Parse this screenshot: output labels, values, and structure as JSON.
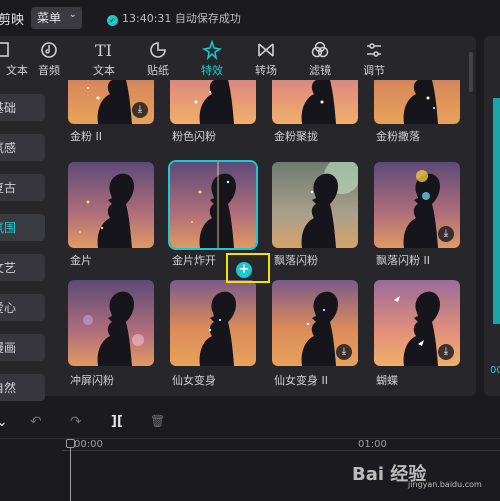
{
  "header": {
    "app_name": "剪映",
    "menu_label": "菜单",
    "save_status": "13:40:31 自动保存成功"
  },
  "tabs": [
    {
      "label": "文本",
      "icon": "text-icon"
    },
    {
      "label": "音频",
      "icon": "audio-icon"
    },
    {
      "label": "文本",
      "icon": "text-t-icon"
    },
    {
      "label": "贴纸",
      "icon": "sticker-icon"
    },
    {
      "label": "特效",
      "icon": "effects-icon",
      "active": true
    },
    {
      "label": "转场",
      "icon": "transition-icon"
    },
    {
      "label": "滤镜",
      "icon": "filter-icon"
    },
    {
      "label": "调节",
      "icon": "adjust-icon"
    }
  ],
  "sidebar": [
    {
      "label": "基础"
    },
    {
      "label": "氛感"
    },
    {
      "label": "复古"
    },
    {
      "label": "氛围",
      "active": true
    },
    {
      "label": "文艺"
    },
    {
      "label": "爱心"
    },
    {
      "label": "漫画"
    },
    {
      "label": "自然"
    }
  ],
  "effects": [
    {
      "label": "金粉 II",
      "download": true
    },
    {
      "label": "粉色闪粉"
    },
    {
      "label": "金粉聚拢"
    },
    {
      "label": "金粉撒落"
    },
    {
      "label": "金片"
    },
    {
      "label": "金片炸开",
      "selected": true,
      "add": "+"
    },
    {
      "label": "飘落闪粉"
    },
    {
      "label": "飘落闪粉 II",
      "download": true
    },
    {
      "label": "冲屏闪粉"
    },
    {
      "label": "仙女变身"
    },
    {
      "label": "仙女变身 II",
      "download": true
    },
    {
      "label": "蝴蝶",
      "download": true
    }
  ],
  "download_glyph": "⤓",
  "right_panel": {
    "bottom_text": "00"
  },
  "timeline": {
    "start_time": "00:00",
    "mark_time": "01:00",
    "split_glyph": "][",
    "undo_glyph": "↶",
    "redo_glyph": "↷",
    "delete_glyph": "🗑",
    "cursor_glyph": "⌄"
  },
  "watermark": {
    "text": "Bai 经验",
    "sub": "jingyan.baidu.com"
  },
  "colors": {
    "accent": "#20c9d1",
    "highlight": "#f1e10d",
    "panel": "#26262b",
    "background": "#1b1b1f"
  }
}
